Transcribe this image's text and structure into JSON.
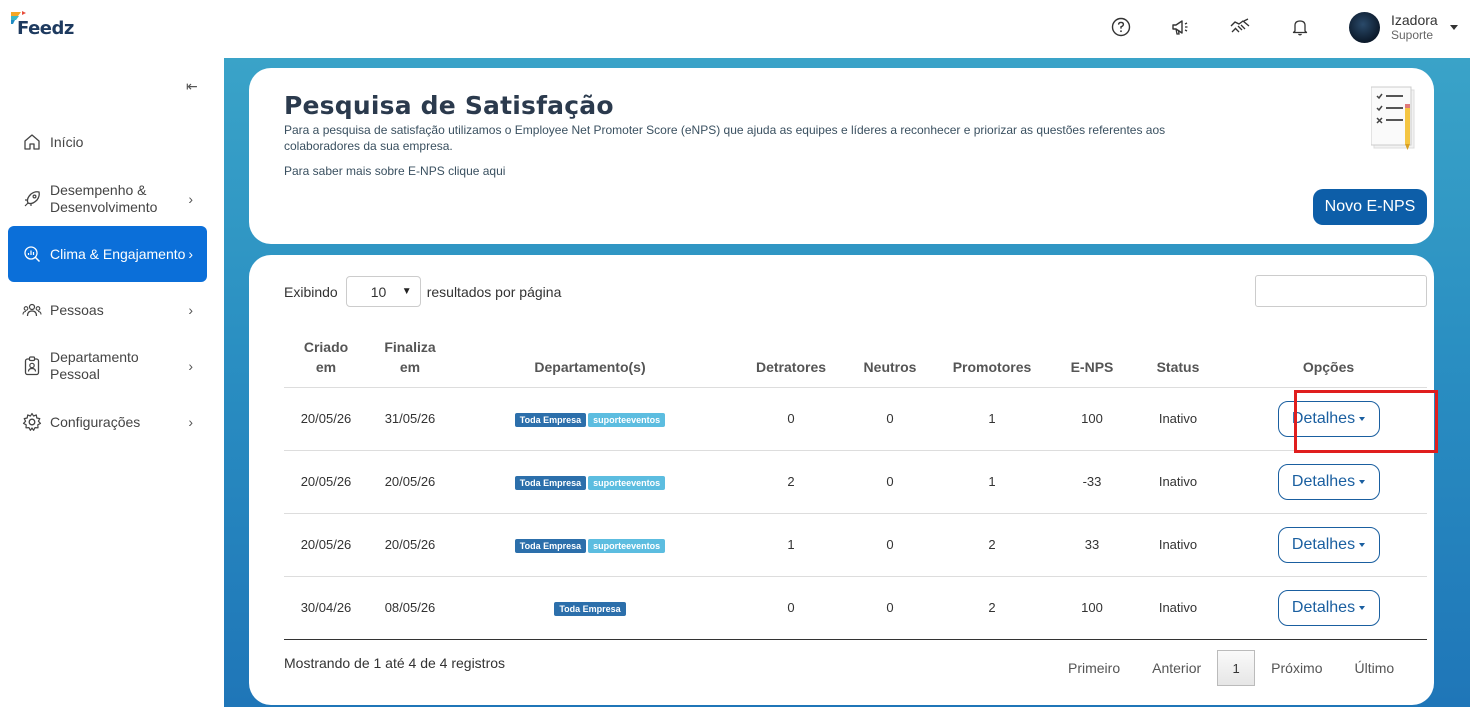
{
  "brand": {
    "name": "Feedz"
  },
  "header": {
    "icons": [
      "help-icon",
      "megaphone-icon",
      "handshake-icon",
      "bell-icon"
    ],
    "user": {
      "name": "Izadora",
      "role": "Suporte"
    }
  },
  "sidebar": {
    "items": [
      {
        "label": "Início",
        "icon": "home-icon",
        "has_chevron": false,
        "active": false
      },
      {
        "label": "Desempenho & Desenvolvimento",
        "icon": "rocket-icon",
        "has_chevron": true,
        "active": false
      },
      {
        "label": "Clima & Engajamento",
        "icon": "chart-search-icon",
        "has_chevron": true,
        "active": true
      },
      {
        "label": "Pessoas",
        "icon": "people-icon",
        "has_chevron": true,
        "active": false
      },
      {
        "label": "Departamento Pessoal",
        "icon": "badge-icon",
        "has_chevron": true,
        "active": false
      },
      {
        "label": "Configurações",
        "icon": "gear-icon",
        "has_chevron": true,
        "active": false
      }
    ]
  },
  "page": {
    "title": "Pesquisa de Satisfação",
    "description": "Para a pesquisa de satisfação utilizamos o Employee Net Promoter Score (eNPS) que ajuda as equipes e líderes a reconhecer e priorizar as questões referentes aos colaboradores da sua empresa.",
    "link": "Para saber mais sobre E-NPS clique aqui",
    "new_button": "Novo E-NPS"
  },
  "table_controls": {
    "show_prefix": "Exibindo",
    "page_size": "10",
    "show_suffix": "resultados por página",
    "search_value": ""
  },
  "table": {
    "headers": [
      "Criado em",
      "Finaliza em",
      "Departamento(s)",
      "Detratores",
      "Neutros",
      "Promotores",
      "E-NPS",
      "Status",
      "Opções"
    ],
    "rows": [
      {
        "criado": "20/05/26",
        "finaliza": "31/05/26",
        "tags": [
          "Toda Empresa",
          "suporteeventos"
        ],
        "detratores": "0",
        "neutros": "0",
        "promotores": "1",
        "enps": "100",
        "status": "Inativo",
        "action": "Detalhes"
      },
      {
        "criado": "20/05/26",
        "finaliza": "20/05/26",
        "tags": [
          "Toda Empresa",
          "suporteeventos"
        ],
        "detratores": "2",
        "neutros": "0",
        "promotores": "1",
        "enps": "-33",
        "status": "Inativo",
        "action": "Detalhes"
      },
      {
        "criado": "20/05/26",
        "finaliza": "20/05/26",
        "tags": [
          "Toda Empresa",
          "suporteeventos"
        ],
        "detratores": "1",
        "neutros": "0",
        "promotores": "2",
        "enps": "33",
        "status": "Inativo",
        "action": "Detalhes"
      },
      {
        "criado": "30/04/26",
        "finaliza": "08/05/26",
        "tags": [
          "Toda Empresa"
        ],
        "detratores": "0",
        "neutros": "0",
        "promotores": "2",
        "enps": "100",
        "status": "Inativo",
        "action": "Detalhes"
      }
    ]
  },
  "footer": {
    "info": "Mostrando de 1 até 4 de 4 registros",
    "pager": {
      "first": "Primeiro",
      "prev": "Anterior",
      "current": "1",
      "next": "Próximo",
      "last": "Último"
    }
  },
  "colors": {
    "accent": "#0b6fd9",
    "primary_button": "#0d5ea8",
    "highlight": "#e01e1e",
    "tag_dark": "#2c6fab",
    "tag_light": "#5cbde0"
  }
}
